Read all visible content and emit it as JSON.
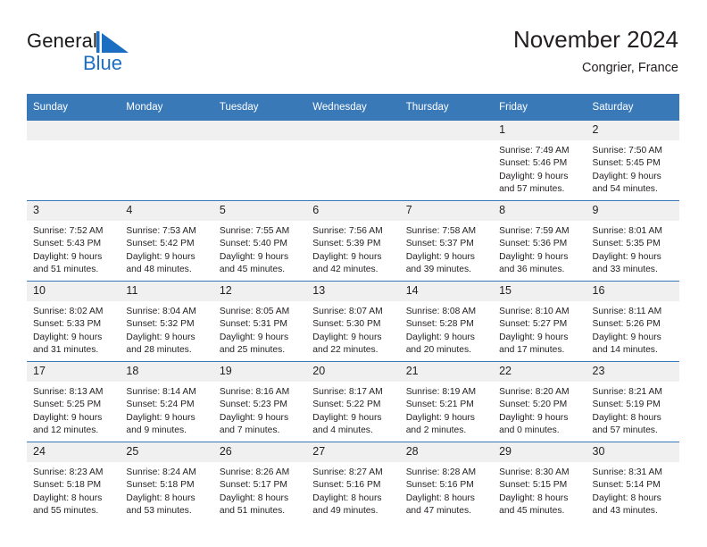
{
  "brand": {
    "name_part1": "General",
    "name_part2": "Blue",
    "mark": "triangle-logo",
    "accent_color": "#1b6ec2"
  },
  "header": {
    "title": "November 2024",
    "location": "Congrier, France"
  },
  "theme": {
    "header_blue": "#3a79b8",
    "daynum_gray": "#f0f0f0",
    "text": "#231f20"
  },
  "calendar": {
    "weekday_headers": [
      "Sunday",
      "Monday",
      "Tuesday",
      "Wednesday",
      "Thursday",
      "Friday",
      "Saturday"
    ],
    "labels": {
      "sunrise": "Sunrise:",
      "sunset": "Sunset:",
      "daylight": "Daylight:"
    },
    "weeks": [
      [
        {
          "day": "",
          "blank": true
        },
        {
          "day": "",
          "blank": true
        },
        {
          "day": "",
          "blank": true
        },
        {
          "day": "",
          "blank": true
        },
        {
          "day": "",
          "blank": true
        },
        {
          "day": "1",
          "sunrise": "Sunrise: 7:49 AM",
          "sunset": "Sunset: 5:46 PM",
          "daylight1": "Daylight: 9 hours",
          "daylight2": "and 57 minutes."
        },
        {
          "day": "2",
          "sunrise": "Sunrise: 7:50 AM",
          "sunset": "Sunset: 5:45 PM",
          "daylight1": "Daylight: 9 hours",
          "daylight2": "and 54 minutes."
        }
      ],
      [
        {
          "day": "3",
          "sunrise": "Sunrise: 7:52 AM",
          "sunset": "Sunset: 5:43 PM",
          "daylight1": "Daylight: 9 hours",
          "daylight2": "and 51 minutes."
        },
        {
          "day": "4",
          "sunrise": "Sunrise: 7:53 AM",
          "sunset": "Sunset: 5:42 PM",
          "daylight1": "Daylight: 9 hours",
          "daylight2": "and 48 minutes."
        },
        {
          "day": "5",
          "sunrise": "Sunrise: 7:55 AM",
          "sunset": "Sunset: 5:40 PM",
          "daylight1": "Daylight: 9 hours",
          "daylight2": "and 45 minutes."
        },
        {
          "day": "6",
          "sunrise": "Sunrise: 7:56 AM",
          "sunset": "Sunset: 5:39 PM",
          "daylight1": "Daylight: 9 hours",
          "daylight2": "and 42 minutes."
        },
        {
          "day": "7",
          "sunrise": "Sunrise: 7:58 AM",
          "sunset": "Sunset: 5:37 PM",
          "daylight1": "Daylight: 9 hours",
          "daylight2": "and 39 minutes."
        },
        {
          "day": "8",
          "sunrise": "Sunrise: 7:59 AM",
          "sunset": "Sunset: 5:36 PM",
          "daylight1": "Daylight: 9 hours",
          "daylight2": "and 36 minutes."
        },
        {
          "day": "9",
          "sunrise": "Sunrise: 8:01 AM",
          "sunset": "Sunset: 5:35 PM",
          "daylight1": "Daylight: 9 hours",
          "daylight2": "and 33 minutes."
        }
      ],
      [
        {
          "day": "10",
          "sunrise": "Sunrise: 8:02 AM",
          "sunset": "Sunset: 5:33 PM",
          "daylight1": "Daylight: 9 hours",
          "daylight2": "and 31 minutes."
        },
        {
          "day": "11",
          "sunrise": "Sunrise: 8:04 AM",
          "sunset": "Sunset: 5:32 PM",
          "daylight1": "Daylight: 9 hours",
          "daylight2": "and 28 minutes."
        },
        {
          "day": "12",
          "sunrise": "Sunrise: 8:05 AM",
          "sunset": "Sunset: 5:31 PM",
          "daylight1": "Daylight: 9 hours",
          "daylight2": "and 25 minutes."
        },
        {
          "day": "13",
          "sunrise": "Sunrise: 8:07 AM",
          "sunset": "Sunset: 5:30 PM",
          "daylight1": "Daylight: 9 hours",
          "daylight2": "and 22 minutes."
        },
        {
          "day": "14",
          "sunrise": "Sunrise: 8:08 AM",
          "sunset": "Sunset: 5:28 PM",
          "daylight1": "Daylight: 9 hours",
          "daylight2": "and 20 minutes."
        },
        {
          "day": "15",
          "sunrise": "Sunrise: 8:10 AM",
          "sunset": "Sunset: 5:27 PM",
          "daylight1": "Daylight: 9 hours",
          "daylight2": "and 17 minutes."
        },
        {
          "day": "16",
          "sunrise": "Sunrise: 8:11 AM",
          "sunset": "Sunset: 5:26 PM",
          "daylight1": "Daylight: 9 hours",
          "daylight2": "and 14 minutes."
        }
      ],
      [
        {
          "day": "17",
          "sunrise": "Sunrise: 8:13 AM",
          "sunset": "Sunset: 5:25 PM",
          "daylight1": "Daylight: 9 hours",
          "daylight2": "and 12 minutes."
        },
        {
          "day": "18",
          "sunrise": "Sunrise: 8:14 AM",
          "sunset": "Sunset: 5:24 PM",
          "daylight1": "Daylight: 9 hours",
          "daylight2": "and 9 minutes."
        },
        {
          "day": "19",
          "sunrise": "Sunrise: 8:16 AM",
          "sunset": "Sunset: 5:23 PM",
          "daylight1": "Daylight: 9 hours",
          "daylight2": "and 7 minutes."
        },
        {
          "day": "20",
          "sunrise": "Sunrise: 8:17 AM",
          "sunset": "Sunset: 5:22 PM",
          "daylight1": "Daylight: 9 hours",
          "daylight2": "and 4 minutes."
        },
        {
          "day": "21",
          "sunrise": "Sunrise: 8:19 AM",
          "sunset": "Sunset: 5:21 PM",
          "daylight1": "Daylight: 9 hours",
          "daylight2": "and 2 minutes."
        },
        {
          "day": "22",
          "sunrise": "Sunrise: 8:20 AM",
          "sunset": "Sunset: 5:20 PM",
          "daylight1": "Daylight: 9 hours",
          "daylight2": "and 0 minutes."
        },
        {
          "day": "23",
          "sunrise": "Sunrise: 8:21 AM",
          "sunset": "Sunset: 5:19 PM",
          "daylight1": "Daylight: 8 hours",
          "daylight2": "and 57 minutes."
        }
      ],
      [
        {
          "day": "24",
          "sunrise": "Sunrise: 8:23 AM",
          "sunset": "Sunset: 5:18 PM",
          "daylight1": "Daylight: 8 hours",
          "daylight2": "and 55 minutes."
        },
        {
          "day": "25",
          "sunrise": "Sunrise: 8:24 AM",
          "sunset": "Sunset: 5:18 PM",
          "daylight1": "Daylight: 8 hours",
          "daylight2": "and 53 minutes."
        },
        {
          "day": "26",
          "sunrise": "Sunrise: 8:26 AM",
          "sunset": "Sunset: 5:17 PM",
          "daylight1": "Daylight: 8 hours",
          "daylight2": "and 51 minutes."
        },
        {
          "day": "27",
          "sunrise": "Sunrise: 8:27 AM",
          "sunset": "Sunset: 5:16 PM",
          "daylight1": "Daylight: 8 hours",
          "daylight2": "and 49 minutes."
        },
        {
          "day": "28",
          "sunrise": "Sunrise: 8:28 AM",
          "sunset": "Sunset: 5:16 PM",
          "daylight1": "Daylight: 8 hours",
          "daylight2": "and 47 minutes."
        },
        {
          "day": "29",
          "sunrise": "Sunrise: 8:30 AM",
          "sunset": "Sunset: 5:15 PM",
          "daylight1": "Daylight: 8 hours",
          "daylight2": "and 45 minutes."
        },
        {
          "day": "30",
          "sunrise": "Sunrise: 8:31 AM",
          "sunset": "Sunset: 5:14 PM",
          "daylight1": "Daylight: 8 hours",
          "daylight2": "and 43 minutes."
        }
      ]
    ]
  }
}
